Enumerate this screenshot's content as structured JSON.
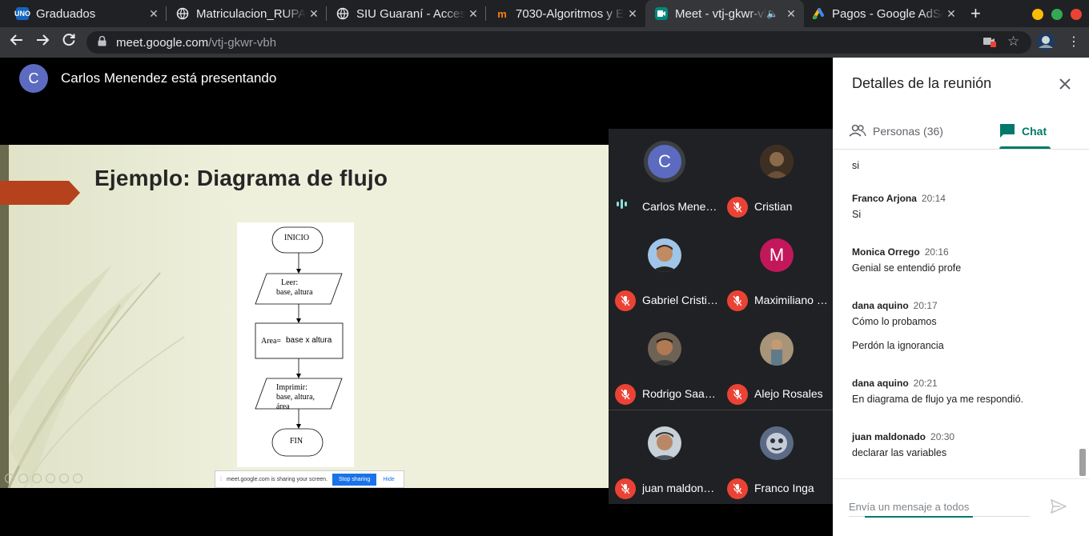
{
  "browser": {
    "tabs": [
      {
        "title": "Graduados",
        "favicon": "uno-logo-icon",
        "fav_text": "UNO"
      },
      {
        "title": "Matriculacion_RUPA",
        "favicon": "globe-icon"
      },
      {
        "title": "SIU Guaraní - Acceso",
        "favicon": "globe-icon"
      },
      {
        "title": "7030-Algoritmos y E",
        "favicon": "moodle-icon"
      },
      {
        "title": "Meet - vtj-gkwr-vbh",
        "favicon": "meet-icon",
        "active": true
      },
      {
        "title": "Pagos - Google AdSe",
        "favicon": "adsense-icon"
      }
    ],
    "url_host": "meet.google.com",
    "url_path": "/vtj-gkwr-vbh"
  },
  "meet": {
    "presenter_initial": "C",
    "presenter_text": "Carlos Menendez está presentando",
    "slide": {
      "title": "Ejemplo: Diagrama de flujo",
      "flowchart": {
        "start": "INICIO",
        "read_line1": "Leer:",
        "read_line2": "base, altura",
        "process_prefix": "Area=",
        "process_rest": "base x altura",
        "print_line1": "Imprimir:",
        "print_line2": "base, altura,",
        "print_line3": "área",
        "end": "FIN"
      },
      "share_notice": "meet.google.com is sharing your screen.",
      "stop_sharing": "Stop sharing",
      "hide": "Hide"
    },
    "participants": [
      {
        "name": "Carlos Menendez",
        "initial": "C",
        "avatar_color": "#5c6bc0",
        "speaking": true
      },
      {
        "name": "Cristian",
        "avatar_color": "#5a4632",
        "photo": true
      },
      {
        "name": "Gabriel Cristino",
        "avatar_color": "#8d6e63",
        "photo": true
      },
      {
        "name": "Maximiliano Rojas",
        "initial": "M",
        "avatar_color": "#c2185b"
      },
      {
        "name": "Rodrigo Saavedra",
        "avatar_color": "#7a6a5a",
        "photo": true
      },
      {
        "name": "Alejo Rosales",
        "avatar_color": "#8a7560",
        "photo": true
      },
      {
        "name": "juan maldonado",
        "avatar_color": "#6d6d6d",
        "photo": true
      },
      {
        "name": "Franco Inga",
        "avatar_color": "#8895a8",
        "photo": true
      }
    ]
  },
  "panel": {
    "title": "Detalles de la reunión",
    "tab_people": "Personas (36)",
    "tab_chat": "Chat",
    "messages": [
      {
        "sender": "",
        "time": "",
        "text": "si"
      },
      {
        "sender": "Franco Arjona",
        "time": "20:14",
        "text": "Si"
      },
      {
        "sender": "Monica Orrego",
        "time": "20:16",
        "text": "Genial se entendió profe"
      },
      {
        "sender": "dana aquino",
        "time": "20:17",
        "text": "Cómo lo probamos"
      },
      {
        "sender": "",
        "time": "",
        "text": "Perdón la ignorancia"
      },
      {
        "sender": "dana aquino",
        "time": "20:21",
        "text": "En diagrama de flujo ya me respondió."
      },
      {
        "sender": "juan maldonado",
        "time": "20:30",
        "text": "declarar las variables"
      }
    ],
    "composer_placeholder": "Envía un mensaje a todos"
  },
  "colors": {
    "accent": "#00796b",
    "mic_muted": "#ea4335",
    "presenter_avatar": "#5c6bc0",
    "slide_accent": "#b5421c"
  }
}
